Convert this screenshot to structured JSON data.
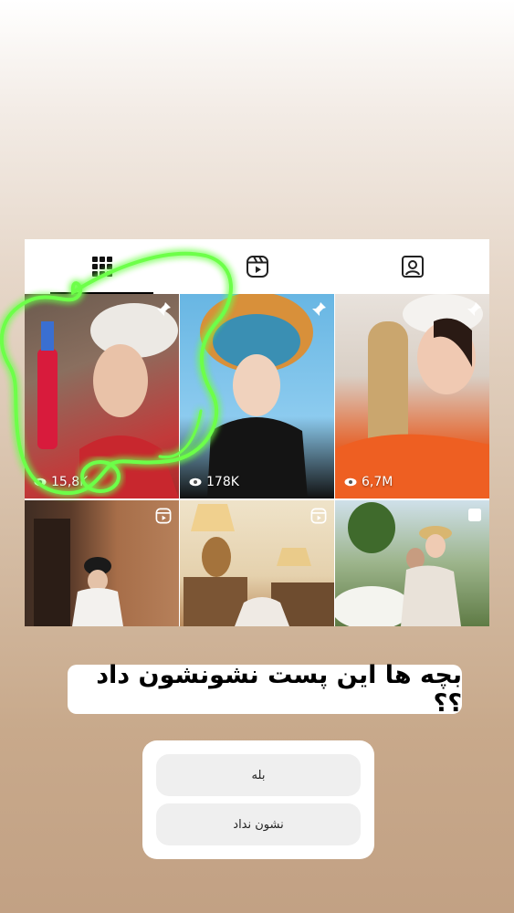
{
  "profile_tabs": [
    {
      "name": "posts-grid",
      "icon": "grid-icon",
      "active": true
    },
    {
      "name": "reels",
      "icon": "reels-icon",
      "active": false
    },
    {
      "name": "tagged",
      "icon": "tagged-user-icon",
      "active": false
    }
  ],
  "posts": [
    {
      "badge": "pin-icon",
      "views": "15,8K",
      "description": "woman in white headscarf holding a red pump bottle"
    },
    {
      "badge": "pin-icon",
      "views": "178K",
      "description": "woman with ornate headdress and blue face paint"
    },
    {
      "badge": "pin-icon",
      "views": "6,7M",
      "description": "woman holding a large loofah"
    },
    {
      "badge": "reels-icon",
      "views": "",
      "description": "person in bucket hat by brick wall"
    },
    {
      "badge": "reels-icon",
      "views": "",
      "description": "interior with lamps and dresser"
    },
    {
      "badge": "multi-post-icon",
      "views": "",
      "description": "couple in garden with flowers"
    }
  ],
  "question_text": "بچه ها این پست نشونشون داد ؟؟",
  "poll": {
    "options": [
      "بله",
      "نشون نداد"
    ]
  },
  "colors": {
    "neon_green": "#6dff4a",
    "card_bg": "#ffffff",
    "poll_option_bg": "#efefef"
  }
}
